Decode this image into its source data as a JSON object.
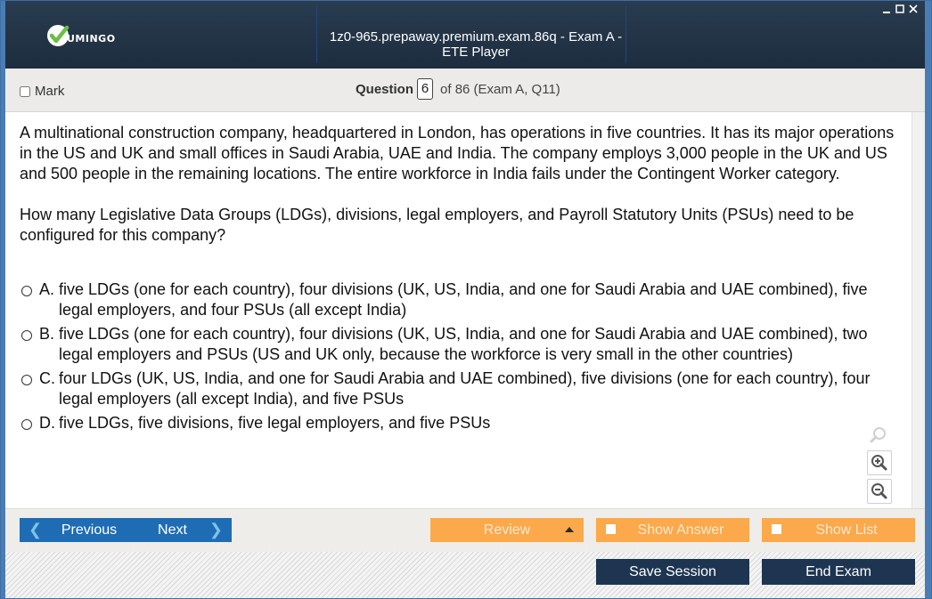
{
  "window": {
    "title": "1z0-965.prepaway.premium.exam.86q - Exam A - ETE Player",
    "logo_text": "UMINGO",
    "controls": [
      "minimize",
      "maximize",
      "close"
    ]
  },
  "question_bar": {
    "mark_label": "Mark",
    "question_label": "Question",
    "question_number": "6",
    "question_suffix": "of 86 (Exam A, Q11)"
  },
  "question": {
    "paragraph1": "A multinational construction company, headquartered in London, has operations in five countries. It has its major operations in the US and UK and small offices in Saudi Arabia, UAE and India. The company employs 3,000 people in the UK and US and 500 people in the remaining locations. The entire workforce in India fails under the Contingent Worker category.",
    "paragraph2": "How many Legislative Data Groups (LDGs), divisions, legal employers, and Payroll Statutory Units (PSUs) need to be configured for this company?",
    "options": [
      {
        "letter": "A.",
        "text": "five LDGs (one for each country), four divisions (UK, US, India, and one for Saudi Arabia and UAE combined), five legal employers, and four PSUs (all except India)"
      },
      {
        "letter": "B.",
        "text": "five LDGs (one for each country), four divisions (UK, US, India, and one for Saudi Arabia and UAE combined), two legal employers and PSUs (US and UK only, because the workforce is very small in the other countries)"
      },
      {
        "letter": "C.",
        "text": "four LDGs (UK, US, India, and one for Saudi Arabia and UAE combined), five divisions (one for each country), four legal employers (all except India), and five PSUs"
      },
      {
        "letter": "D.",
        "text": "five LDGs, five divisions, five legal employers, and five PSUs"
      }
    ]
  },
  "zoom": {
    "icons": [
      "search-icon",
      "zoom-in-icon",
      "zoom-out-icon"
    ]
  },
  "nav": {
    "previous_label": "Previous",
    "next_label": "Next",
    "review_label": "Review",
    "show_answer_label": "Show Answer",
    "show_list_label": "Show List",
    "save_session_label": "Save Session",
    "end_exam_label": "End Exam"
  },
  "colors": {
    "titlebar": "#1d2d3f",
    "nav_blue": "#1e6db4",
    "review_orange": "#fba94b",
    "dark_button": "#1d3550",
    "logo_green": "#6dbe45"
  }
}
